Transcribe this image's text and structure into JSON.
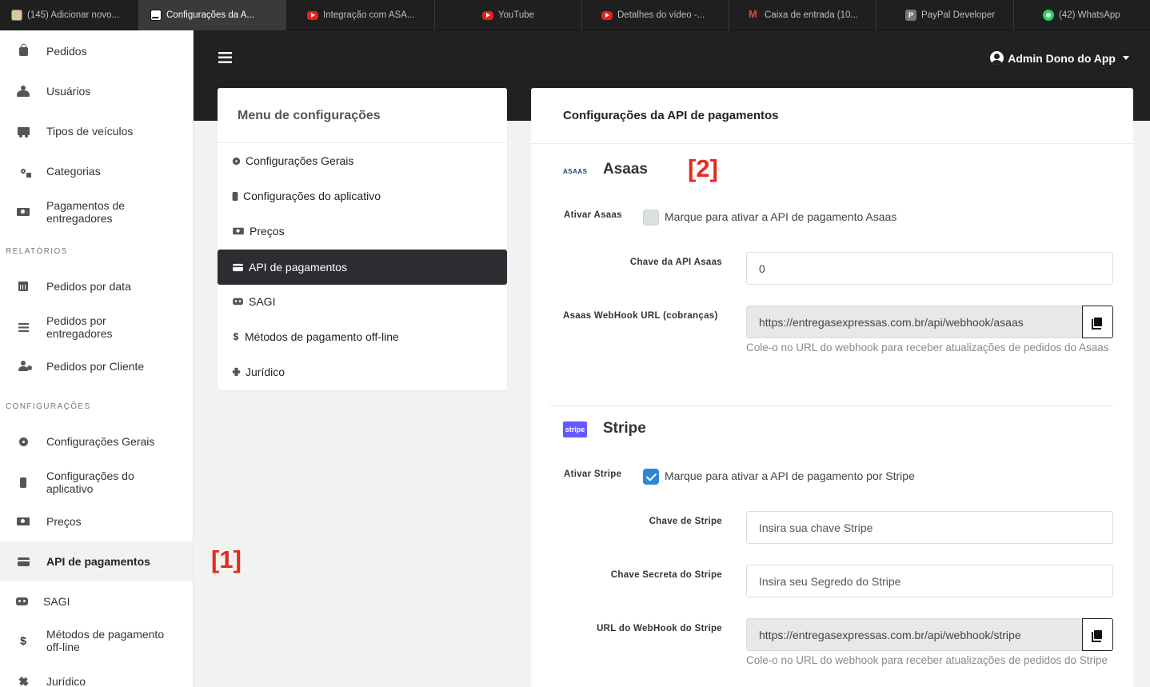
{
  "browser_tabs": [
    {
      "label": "(145) Adicionar novo...",
      "icon": "thumbnail-icon",
      "active": false
    },
    {
      "label": "Configurações da A...",
      "icon": "app-icon",
      "active": true
    },
    {
      "label": "Integração com ASA...",
      "icon": "youtube-icon",
      "active": false
    },
    {
      "label": "YouTube",
      "icon": "youtube-icon",
      "active": false
    },
    {
      "label": "Detalhes do vídeo -...",
      "icon": "youtube-icon",
      "active": false
    },
    {
      "label": "Caixa de entrada (10...",
      "icon": "gmail-icon",
      "active": false
    },
    {
      "label": "PayPal Developer",
      "icon": "paypal-icon",
      "active": false
    },
    {
      "label": "(42) WhatsApp",
      "icon": "whatsapp-icon",
      "active": false
    }
  ],
  "sidebar": {
    "items": [
      {
        "label": "Pedidos",
        "icon": "shopping-bag-icon"
      },
      {
        "label": "Usuários",
        "icon": "users-icon"
      },
      {
        "label": "Tipos de veículos",
        "icon": "truck-icon"
      },
      {
        "label": "Categorias",
        "icon": "shapes-icon"
      },
      {
        "label": "Pagamentos de entregadores",
        "icon": "money-bill-icon"
      }
    ],
    "heading_reports": "RELATÓRIOS",
    "report_items": [
      {
        "label": "Pedidos por data",
        "icon": "calendar-icon"
      },
      {
        "label": "Pedidos por entregadores",
        "icon": "list-icon"
      },
      {
        "label": "Pedidos por Cliente",
        "icon": "user-clock-icon"
      }
    ],
    "heading_settings": "CONFIGURAÇÕES",
    "settings_items": [
      {
        "label": "Configurações Gerais",
        "icon": "gear-icon"
      },
      {
        "label": "Configurações do aplicativo",
        "icon": "mobile-icon"
      },
      {
        "label": "Preços",
        "icon": "money-bill-icon"
      },
      {
        "label": "API de pagamentos",
        "icon": "credit-card-icon",
        "active": true
      },
      {
        "label": "SAGI",
        "icon": "robot-icon"
      },
      {
        "label": "Métodos de pagamento off-line",
        "icon": "dollar-icon"
      },
      {
        "label": "Jurídico",
        "icon": "gavel-icon"
      }
    ]
  },
  "header": {
    "user_name": "Admin Dono do App"
  },
  "settings_menu": {
    "title": "Menu de configurações",
    "items": [
      {
        "label": "Configurações Gerais",
        "icon": "gear-icon"
      },
      {
        "label": "Configurações do aplicativo",
        "icon": "mobile-icon"
      },
      {
        "label": "Preços",
        "icon": "money-bill-icon"
      },
      {
        "label": "API de pagamentos",
        "icon": "credit-card-icon",
        "active": true
      },
      {
        "label": "SAGI",
        "icon": "robot-icon"
      },
      {
        "label": "Métodos de pagamento off-line",
        "icon": "dollar-icon"
      },
      {
        "label": "Jurídico",
        "icon": "gavel-icon"
      }
    ]
  },
  "content": {
    "title": "Configurações da API de pagamentos",
    "asaas": {
      "logo_text": "ASAAS",
      "name": "Asaas",
      "enable_label": "Ativar Asaas",
      "enable_text": "Marque para ativar a API de pagamento Asaas",
      "enabled": false,
      "key_label": "Chave da API Asaas",
      "key_value": "0",
      "webhook_label": "Asaas WebHook URL (cobranças)",
      "webhook_value": "https://entregasexpressas.com.br/api/webhook/asaas",
      "webhook_help": "Cole-o no URL do webhook para receber atualizações de pedidos do Asaas"
    },
    "stripe": {
      "logo_text": "stripe",
      "name": "Stripe",
      "enable_label": "Ativar Stripe",
      "enable_text": "Marque para ativar a API de pagamento por Stripe",
      "enabled": true,
      "key_label": "Chave de Stripe",
      "key_placeholder": "Insira sua chave Stripe",
      "secret_label": "Chave Secreta do Stripe",
      "secret_placeholder": "Insira seu Segredo do Stripe",
      "webhook_label": "URL do WebHook do Stripe",
      "webhook_value": "https://entregasexpressas.com.br/api/webhook/stripe",
      "webhook_help": "Cole-o no URL do webhook para receber atualizações de pedidos do Stripe"
    }
  },
  "annotations": [
    "[1]",
    "[2]"
  ],
  "colors": {
    "annotation_red": "#e62a1c",
    "dark_header": "#212121",
    "active_menu": "#2b2d30",
    "checkbox_on": "#2f86d8",
    "stripe_brand": "#635bff"
  }
}
